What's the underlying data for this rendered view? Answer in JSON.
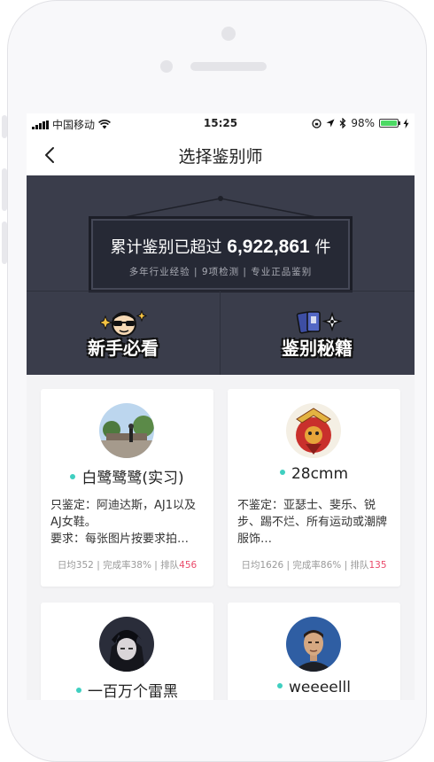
{
  "status_bar": {
    "carrier": "中国移动",
    "time": "15:25",
    "battery": "98%",
    "battery_level": 0.98
  },
  "nav": {
    "title": "选择鉴别师",
    "back_icon": "chevron-left-icon"
  },
  "banner": {
    "headline_prefix": "累计鉴别已超过",
    "count": "6,922,861",
    "headline_suffix": "件",
    "subtitle": "多年行业经验 | 9项检测 | 专业正品鉴别",
    "features": [
      {
        "label": "新手必看",
        "icon": "cool-face-sparkle-icon"
      },
      {
        "label": "鉴别秘籍",
        "icon": "cards-shuriken-icon"
      }
    ]
  },
  "appraisers": [
    {
      "name": "白鹭鹭鹭(实习)",
      "status_color": "#3fcfc0",
      "desc_line1": "只鉴定：阿迪达斯，AJ1以及AJ女鞋。",
      "desc_line2": "要求：每张图片按要求拍…",
      "stat_daily": "日均352",
      "stat_rate": "完成率38%",
      "stat_queue_label": "排队",
      "stat_queue": "456"
    },
    {
      "name": "28cmm",
      "status_color": "#3fcfc0",
      "desc_line1": "不鉴定：亚瑟士、斐乐、锐步、踢不烂、所有运动或潮牌服饰…",
      "desc_line2": "",
      "stat_daily": "日均1626",
      "stat_rate": "完成率86%",
      "stat_queue_label": "排队",
      "stat_queue": "135"
    },
    {
      "name": "一百万个雷黑",
      "status_color": "#3fcfc0"
    },
    {
      "name": "weeeelll",
      "status_color": "#3fcfc0"
    }
  ],
  "colors": {
    "banner_bg": "#3a3d4b",
    "accent_queue": "#ea4a6a",
    "online_dot": "#3fcfc0",
    "battery_green": "#4cd964"
  }
}
